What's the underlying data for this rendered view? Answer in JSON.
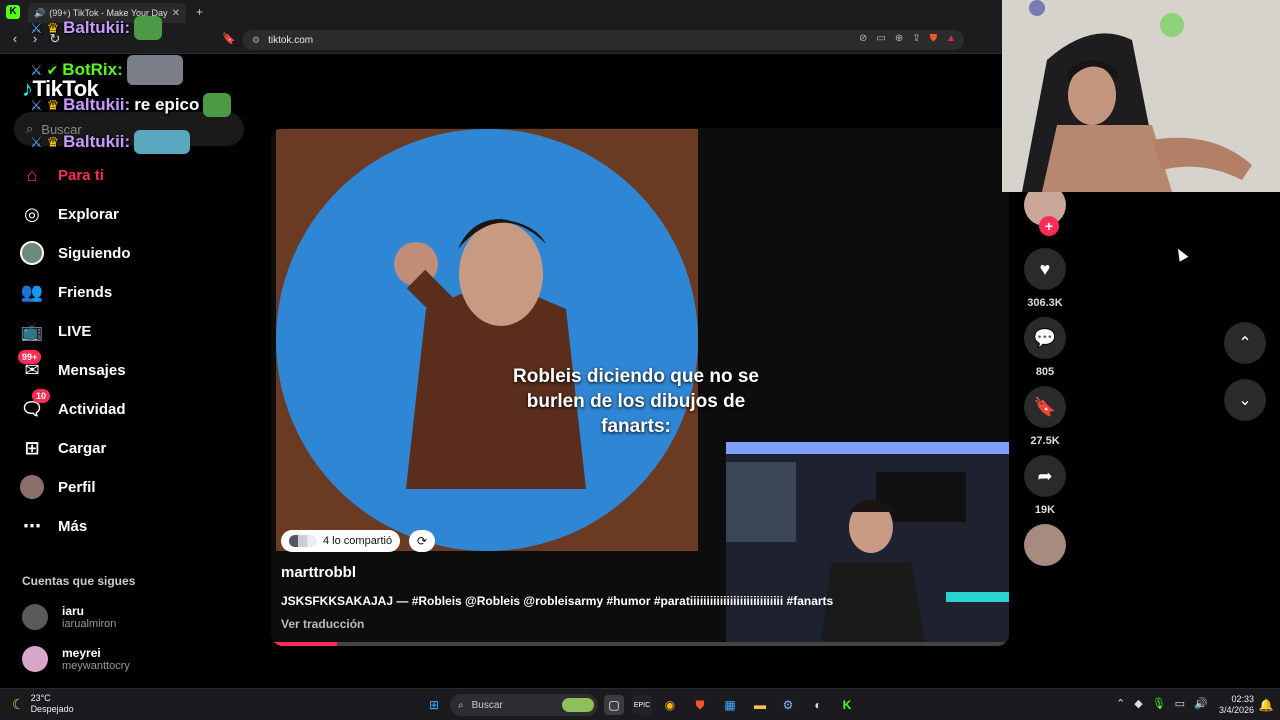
{
  "browser": {
    "tab_title": "(99+) TikTok - Make Your Day",
    "url": "tiktok.com"
  },
  "sidebar": {
    "logo": "TikTok",
    "search_placeholder": "Buscar",
    "nav": [
      {
        "label": "Para ti",
        "icon": "home-icon"
      },
      {
        "label": "Explorar",
        "icon": "compass-icon"
      },
      {
        "label": "Siguiendo",
        "icon": "following-avatar-icon"
      },
      {
        "label": "Friends",
        "icon": "friends-icon"
      },
      {
        "label": "LIVE",
        "icon": "live-tv-icon"
      },
      {
        "label": "Mensajes",
        "icon": "messages-icon",
        "badge": "99+"
      },
      {
        "label": "Actividad",
        "icon": "activity-icon",
        "badge": "10"
      },
      {
        "label": "Cargar",
        "icon": "upload-icon"
      },
      {
        "label": "Perfil",
        "icon": "profile-avatar-icon"
      },
      {
        "label": "Más",
        "icon": "more-dots-icon"
      }
    ],
    "following_title": "Cuentas que sigues",
    "following": [
      {
        "name": "iaru",
        "handle": "iarualmiron"
      },
      {
        "name": "meyrei",
        "handle": "meywanttocry"
      }
    ]
  },
  "video": {
    "overlay_text": "Robleis diciendo que no se burlen de los dibujos de fanarts:",
    "shared_label": "4 lo compartió",
    "author": "marttrobbl",
    "caption": "JSKSFKKSAKAJAJ — #Robleis @Robleis @robleisarmy #humor #paratiiiiiiiiiiiiiiiiiiiiiiiiiiii #fanarts",
    "translate": "Ver traducción",
    "progress": 0.09
  },
  "actions": {
    "likes": "306.3K",
    "comments": "805",
    "saves": "27.5K",
    "shares": "19K"
  },
  "chat": [
    {
      "user": "Baltukii:",
      "message": "",
      "color": "#c89cff"
    },
    {
      "user": "BotRix:",
      "message": "",
      "color": "#53fc18"
    },
    {
      "user": "Baltukii:",
      "message": "re epico",
      "color": "#c89cff"
    },
    {
      "user": "Baltukii:",
      "message": "",
      "color": "#c89cff"
    }
  ],
  "taskbar": {
    "temperature": "23°C",
    "weather": "Despejado",
    "search": "Buscar",
    "time": "02:33",
    "date": "3/4/2026"
  },
  "colors": {
    "accent": "#fe2c55",
    "kick_green": "#53fc18"
  }
}
